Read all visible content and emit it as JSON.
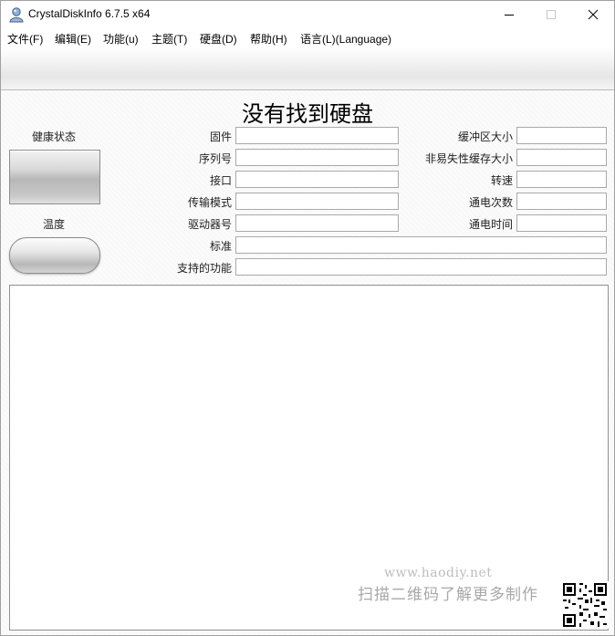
{
  "window": {
    "title": "CrystalDiskInfo 6.7.5 x64",
    "minimize_glyph": "—",
    "maximize_glyph": "☐",
    "close_glyph": "✕"
  },
  "menu": {
    "items": [
      {
        "label": "文件(F)"
      },
      {
        "label": "编辑(E)"
      },
      {
        "label": "功能(u)"
      },
      {
        "label": "主题(T)"
      },
      {
        "label": "硬盘(D)"
      },
      {
        "label": "帮助(H)"
      },
      {
        "label": "语言(L)(Language)"
      }
    ]
  },
  "disk": {
    "title": "没有找到硬盘"
  },
  "status": {
    "health_label": "健康状态",
    "health_value": "",
    "temperature_label": "温度",
    "temperature_value": ""
  },
  "fields": {
    "firmware": {
      "label": "固件",
      "value": ""
    },
    "serial": {
      "label": "序列号",
      "value": ""
    },
    "interface": {
      "label": "接口",
      "value": ""
    },
    "transfer_mode": {
      "label": "传输模式",
      "value": ""
    },
    "drive_letter": {
      "label": "驱动器号",
      "value": ""
    },
    "standard": {
      "label": "标准",
      "value": ""
    },
    "features": {
      "label": "支持的功能",
      "value": ""
    },
    "buffer_size": {
      "label": "缓冲区大小",
      "value": ""
    },
    "nv_cache_size": {
      "label": "非易失性缓存大小",
      "value": ""
    },
    "rotation_rate": {
      "label": "转速",
      "value": ""
    },
    "power_on_count": {
      "label": "通电次数",
      "value": ""
    },
    "power_on_hours": {
      "label": "通电时间",
      "value": ""
    }
  },
  "watermark": {
    "url": "www.haodiy.net",
    "text": "扫描二维码了解更多制作"
  },
  "icons": {
    "app": "crystaldiskinfo-icon",
    "qr": "qr-code-icon"
  },
  "colors": {
    "border": "#a9a9a9",
    "toolbar": "#e6e6e6",
    "watermark": "#a8a8a8"
  }
}
